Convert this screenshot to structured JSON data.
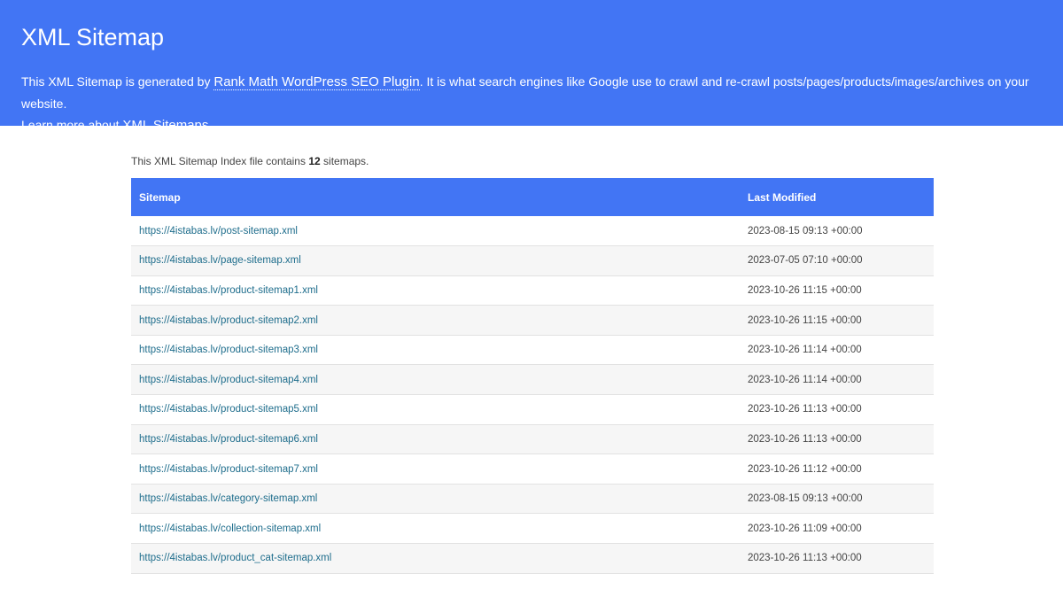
{
  "header": {
    "title": "XML Sitemap",
    "desc_part1": "This XML Sitemap is generated by ",
    "plugin_link": "Rank Math WordPress SEO Plugin",
    "desc_part2": ". It is what search engines like Google use to crawl and re-crawl posts/pages/products/images/archives on your website.",
    "desc_part3": "Learn more about ",
    "sitemaps_link": "XML Sitemaps",
    "desc_part4": "."
  },
  "summary": {
    "prefix": "This XML Sitemap Index file contains ",
    "count": "12",
    "suffix": " sitemaps."
  },
  "table": {
    "columns": [
      "Sitemap",
      "Last Modified"
    ],
    "rows": [
      {
        "url": "https://4istabas.lv/post-sitemap.xml",
        "modified": "2023-08-15 09:13 +00:00"
      },
      {
        "url": "https://4istabas.lv/page-sitemap.xml",
        "modified": "2023-07-05 07:10 +00:00"
      },
      {
        "url": "https://4istabas.lv/product-sitemap1.xml",
        "modified": "2023-10-26 11:15 +00:00"
      },
      {
        "url": "https://4istabas.lv/product-sitemap2.xml",
        "modified": "2023-10-26 11:15 +00:00"
      },
      {
        "url": "https://4istabas.lv/product-sitemap3.xml",
        "modified": "2023-10-26 11:14 +00:00"
      },
      {
        "url": "https://4istabas.lv/product-sitemap4.xml",
        "modified": "2023-10-26 11:14 +00:00"
      },
      {
        "url": "https://4istabas.lv/product-sitemap5.xml",
        "modified": "2023-10-26 11:13 +00:00"
      },
      {
        "url": "https://4istabas.lv/product-sitemap6.xml",
        "modified": "2023-10-26 11:13 +00:00"
      },
      {
        "url": "https://4istabas.lv/product-sitemap7.xml",
        "modified": "2023-10-26 11:12 +00:00"
      },
      {
        "url": "https://4istabas.lv/category-sitemap.xml",
        "modified": "2023-08-15 09:13 +00:00"
      },
      {
        "url": "https://4istabas.lv/collection-sitemap.xml",
        "modified": "2023-10-26 11:09 +00:00"
      },
      {
        "url": "https://4istabas.lv/product_cat-sitemap.xml",
        "modified": "2023-10-26 11:13 +00:00"
      }
    ]
  },
  "colors": {
    "brand": "#4275f4",
    "link": "#1e6d8c"
  }
}
